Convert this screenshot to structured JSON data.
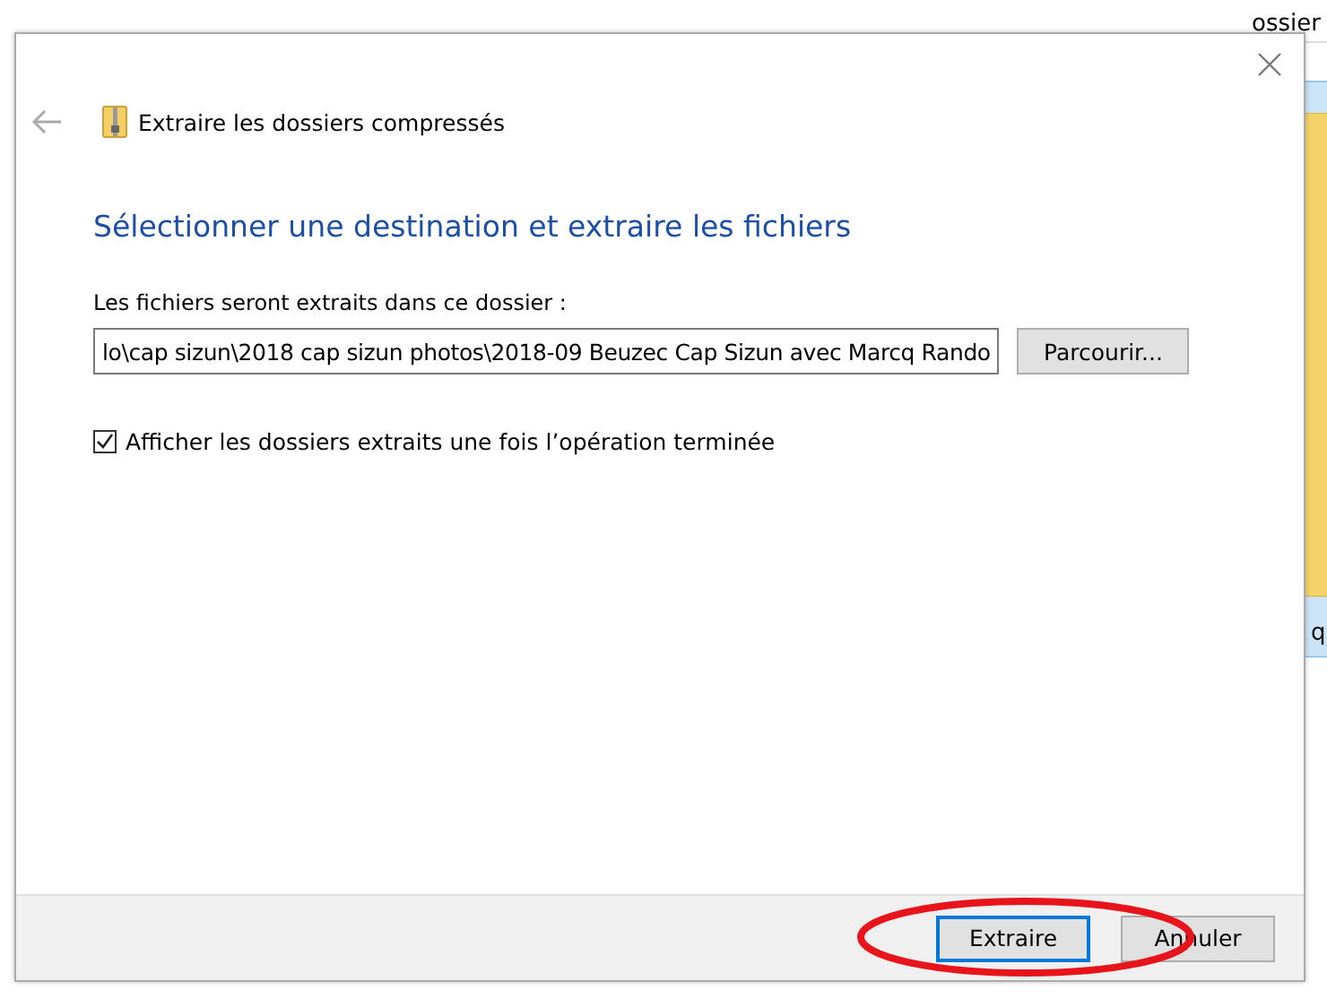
{
  "background_window": {
    "column_header": "ossier",
    "item_label": "q"
  },
  "dialog": {
    "title": "Extraire les dossiers compressés",
    "heading": "Sélectionner une destination et extraire les fichiers",
    "destination_label": "Les fichiers seront extraits dans ce dossier :",
    "destination_path": "lo\\cap sizun\\2018 cap sizun photos\\2018-09 Beuzec Cap Sizun avec Marcq Rando",
    "browse_button": "Parcourir...",
    "show_folders": {
      "label": "Afficher les dossiers extraits une fois l’opération terminée",
      "checked": true
    },
    "buttons": [
      {
        "label": "Extraire",
        "default": true
      },
      {
        "label": "Annuler",
        "default": false
      }
    ]
  }
}
